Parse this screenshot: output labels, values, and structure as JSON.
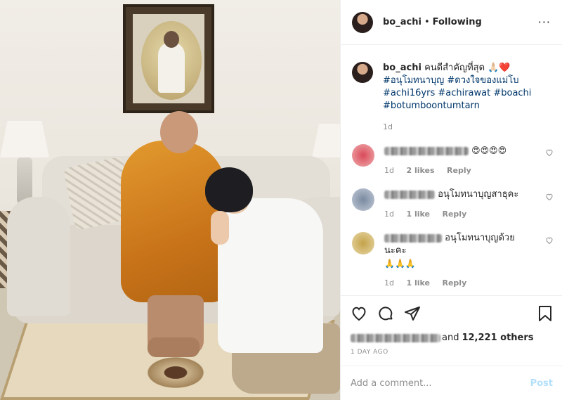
{
  "header": {
    "username": "bo_achi",
    "separator": "•",
    "follow_status": "Following",
    "more": "···"
  },
  "caption": {
    "username": "bo_achi",
    "text": "คนดีสำคัญที่สุด 🙏🏻❤️",
    "hashtags_line1": "#อนุโมทนาบุญ #ดวงใจของแม่โบ",
    "hashtags_line2": "#achi16yrs #achirawat #boachi",
    "hashtags_line3": "#botumboontumtarn",
    "age": "1d"
  },
  "comments": [
    {
      "text": "😍😍😍😍",
      "age": "1d",
      "likes": "2 likes",
      "reply": "Reply",
      "avatar_color": "#d94a5a"
    },
    {
      "text": "อนุโมทนาบุญสาธุคะ",
      "age": "1d",
      "likes": "1 like",
      "reply": "Reply",
      "avatar_color": "#7a8aa0"
    },
    {
      "text": "อนุโมทนาบุญด้วยนะคะ",
      "text2": "🙏🙏🙏",
      "age": "1d",
      "likes": "1 like",
      "reply": "Reply",
      "avatar_color": "#c4a24a"
    }
  ],
  "likes": {
    "prefix": "and",
    "count": "12,221 others"
  },
  "date": "1 DAY AGO",
  "add_comment": {
    "placeholder": "Add a comment...",
    "post": "Post"
  },
  "colors": {
    "link": "#00376b",
    "muted": "#8e8e8e",
    "post_disabled": "#b2dffc"
  }
}
